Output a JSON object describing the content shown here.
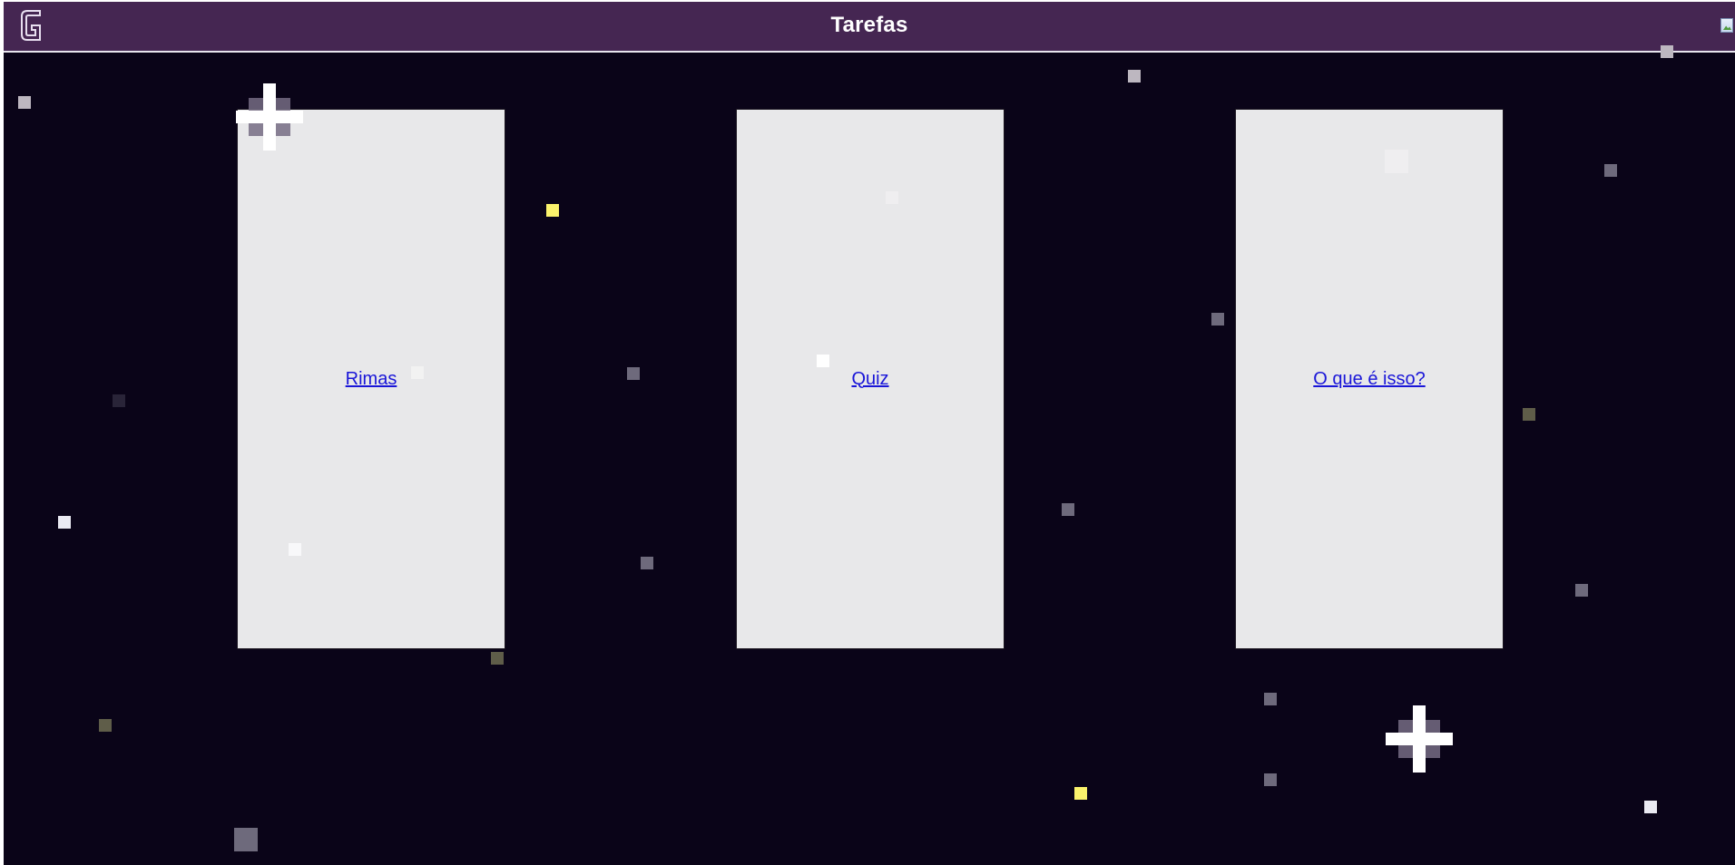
{
  "header": {
    "title": "Tarefas",
    "logo_icon": "g-logo-icon",
    "image_icon": "broken-image-icon"
  },
  "cards": [
    {
      "label": "Rimas"
    },
    {
      "label": "Quiz"
    },
    {
      "label": "O que é isso?"
    }
  ],
  "theme": {
    "background": "#0a0418",
    "header": "#452652",
    "card": "#e8e8ea",
    "link": "#1a16d8",
    "star_white": "#ffffff",
    "star_gray": "#6e6a7c",
    "star_yellow": "#fbf36c",
    "star_olive": "#5f5d49"
  }
}
